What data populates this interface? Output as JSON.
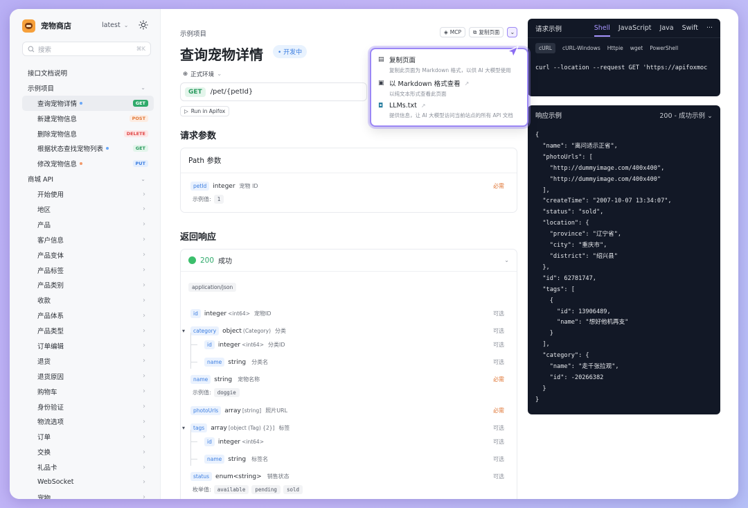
{
  "sidebar": {
    "brand": "宠物商店",
    "version": "latest",
    "search_placeholder": "搜索",
    "search_shortcut": "⌘K",
    "items": [
      {
        "label": "接口文档说明",
        "kind": "top"
      },
      {
        "label": "示例项目",
        "kind": "group"
      },
      {
        "label": "查询宠物详情",
        "kind": "api",
        "method": "GET",
        "dot": "#6aa8f7",
        "active": true
      },
      {
        "label": "新建宠物信息",
        "kind": "api",
        "method": "POST"
      },
      {
        "label": "删除宠物信息",
        "kind": "api",
        "method": "DELETE"
      },
      {
        "label": "根据状态查找宠物列表",
        "kind": "api",
        "method": "GET",
        "dot": "#6aa8f7",
        "soft": true
      },
      {
        "label": "修改宠物信息",
        "kind": "api",
        "method": "PUT",
        "dot": "#f29a6b"
      },
      {
        "label": "商城 API",
        "kind": "group"
      },
      {
        "label": "开始使用",
        "kind": "folder"
      },
      {
        "label": "地区",
        "kind": "folder"
      },
      {
        "label": "产品",
        "kind": "folder"
      },
      {
        "label": "客户信息",
        "kind": "folder"
      },
      {
        "label": "产品变体",
        "kind": "folder"
      },
      {
        "label": "产品标签",
        "kind": "folder"
      },
      {
        "label": "产品类别",
        "kind": "folder"
      },
      {
        "label": "收款",
        "kind": "folder"
      },
      {
        "label": "产品体系",
        "kind": "folder"
      },
      {
        "label": "产品类型",
        "kind": "folder"
      },
      {
        "label": "订单编辑",
        "kind": "folder"
      },
      {
        "label": "退货",
        "kind": "folder"
      },
      {
        "label": "退货原因",
        "kind": "folder"
      },
      {
        "label": "购物车",
        "kind": "folder"
      },
      {
        "label": "身份验证",
        "kind": "folder"
      },
      {
        "label": "物流选项",
        "kind": "folder"
      },
      {
        "label": "订单",
        "kind": "folder"
      },
      {
        "label": "交换",
        "kind": "folder"
      },
      {
        "label": "礼品卡",
        "kind": "folder"
      },
      {
        "label": "WebSocket",
        "kind": "folder"
      },
      {
        "label": "宠物",
        "kind": "folder"
      }
    ]
  },
  "main": {
    "breadcrumb": "示例项目",
    "title": "查询宠物详情",
    "status": "开发中",
    "mcp_label": "MCP",
    "copy_label": "复制页面",
    "env": "正式环境",
    "method": "GET",
    "path": "/pet/{petId}",
    "run_label": "Run in Apifox",
    "request_heading": "请求参数",
    "path_params_heading": "Path 参数",
    "path_param": {
      "name": "petId",
      "type": "integer",
      "desc": "宠物 ID",
      "required": "必需",
      "example_label": "示例值:",
      "example": "1"
    },
    "response_heading": "返回响应",
    "response_code": "200",
    "response_text": "成功",
    "content_type": "application/json",
    "fields": [
      {
        "name": "id",
        "type": "integer",
        "fmt": "<int64>",
        "desc": "宠物ID",
        "flag": "可选"
      },
      {
        "name": "category",
        "type": "object",
        "fmt": "(Category)",
        "desc": "分类",
        "flag": "可选"
      },
      {
        "name": "id",
        "type": "integer",
        "fmt": "<int64>",
        "desc": "分类ID",
        "flag": "可选"
      },
      {
        "name": "name",
        "type": "string",
        "fmt": "",
        "desc": "分类名",
        "flag": "可选"
      },
      {
        "name": "name",
        "type": "string",
        "fmt": "",
        "desc": "宠物名称",
        "flag": "必需",
        "example": "doggie"
      },
      {
        "name": "photoUrls",
        "type": "array",
        "fmt": "[string]",
        "desc": "照片URL",
        "flag": "必需"
      },
      {
        "name": "tags",
        "type": "array",
        "fmt": "[object (Tag) {2}]",
        "desc": "标签",
        "flag": "可选"
      },
      {
        "name": "id",
        "type": "integer",
        "fmt": "<int64>",
        "desc": "",
        "flag": "可选"
      },
      {
        "name": "name",
        "type": "string",
        "fmt": "",
        "desc": "标签名",
        "flag": "可选"
      },
      {
        "name": "status",
        "type": "enum<string>",
        "fmt": "",
        "desc": "销售状态",
        "flag": "可选"
      }
    ],
    "example_label": "示例值:",
    "enum_label": "枚举值:",
    "enum_values": [
      "available",
      "pending",
      "sold"
    ]
  },
  "dropdown": {
    "items": [
      {
        "title": "复制页面",
        "desc": "复制此页面为 Markdown 格式，以供 AI 大模型使用"
      },
      {
        "title": "以 Markdown 格式查看",
        "desc": "以纯文本形式查看此页面"
      },
      {
        "title": "LLMs.txt",
        "desc": "提供信息，让 AI 大模型访问当前站点的所有 API 文档"
      }
    ]
  },
  "request_example": {
    "title": "请求示例",
    "tabs": [
      "Shell",
      "JavaScript",
      "Java",
      "Swift",
      "···"
    ],
    "subtabs": [
      "cURL",
      "cURL-Windows",
      "Httpie",
      "wget",
      "PowerShell"
    ],
    "code": "curl --location --request GET 'https://apifoxmoc"
  },
  "response_example": {
    "title": "响应示例",
    "selector": "200 - 成功示例",
    "code": "{\n  \"name\": \"离问适示正省\",\n  \"photoUrls\": [\n    \"http://dummyimage.com/400x400\",\n    \"http://dummyimage.com/400x400\"\n  ],\n  \"createTime\": \"2007-10-07 13:34:07\",\n  \"status\": \"sold\",\n  \"location\": {\n    \"province\": \"辽宁省\",\n    \"city\": \"重庆市\",\n    \"district\": \"绍兴县\"\n  },\n  \"id\": 62781747,\n  \"tags\": [\n    {\n      \"id\": 13906489,\n      \"name\": \"想好他机再支\"\n    }\n  ],\n  \"category\": {\n    \"name\": \"走千张拉观\",\n    \"id\": -20266382\n  }\n}"
  }
}
